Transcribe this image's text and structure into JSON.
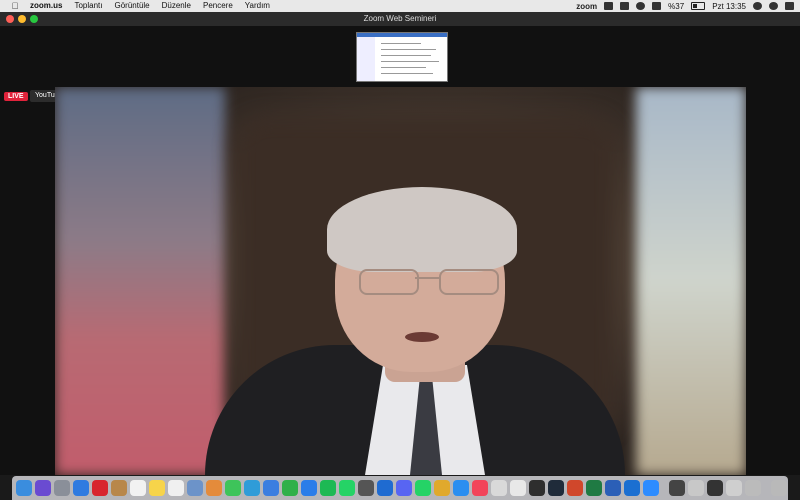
{
  "menubar": {
    "app_name": "zoom.us",
    "items": [
      "Toplantı",
      "Görüntüle",
      "Düzenle",
      "Pencere",
      "Yardım"
    ],
    "status": {
      "zoom": "zoom",
      "battery": "%37",
      "time": "Pzt 13:35"
    }
  },
  "window": {
    "title": "Zoom Web Semineri"
  },
  "stream": {
    "live_label": "LIVE",
    "platform_label": "YouTube"
  },
  "dock": {
    "apps": [
      {
        "name": "finder",
        "color": "#3a8dde"
      },
      {
        "name": "siri",
        "color": "#6a4bd1"
      },
      {
        "name": "launchpad",
        "color": "#8a8f99"
      },
      {
        "name": "safari",
        "color": "#2f7be0"
      },
      {
        "name": "opera",
        "color": "#d8252e"
      },
      {
        "name": "notes-brown",
        "color": "#b8874a"
      },
      {
        "name": "calendar",
        "color": "#f2f2f2"
      },
      {
        "name": "notes",
        "color": "#f7d44a"
      },
      {
        "name": "reminders",
        "color": "#f0f0f0"
      },
      {
        "name": "preview",
        "color": "#6c93c9"
      },
      {
        "name": "photos",
        "color": "#e48b3b"
      },
      {
        "name": "messages",
        "color": "#3ec45a"
      },
      {
        "name": "facetime-blue",
        "color": "#2f9cd8"
      },
      {
        "name": "keynote",
        "color": "#3b7ee0"
      },
      {
        "name": "numbers",
        "color": "#2fb04a"
      },
      {
        "name": "app-store",
        "color": "#2b7de9"
      },
      {
        "name": "spotify",
        "color": "#1db954"
      },
      {
        "name": "whatsapp",
        "color": "#25d366"
      },
      {
        "name": "camera",
        "color": "#555"
      },
      {
        "name": "outlook",
        "color": "#1f6bd1"
      },
      {
        "name": "discord",
        "color": "#5865f2"
      },
      {
        "name": "whatsapp-2",
        "color": "#25d366"
      },
      {
        "name": "chrome",
        "color": "#e0a92c"
      },
      {
        "name": "messenger",
        "color": "#2b8ef0"
      },
      {
        "name": "music",
        "color": "#f2445a"
      },
      {
        "name": "word-doc",
        "color": "#d9d9d9"
      },
      {
        "name": "sheets",
        "color": "#e8e8e8"
      },
      {
        "name": "activity-monitor",
        "color": "#2e2e2e"
      },
      {
        "name": "vpn",
        "color": "#1f2b3a"
      },
      {
        "name": "powerpoint",
        "color": "#d0472b"
      },
      {
        "name": "excel",
        "color": "#1f7a43"
      },
      {
        "name": "word",
        "color": "#2b5fb7"
      },
      {
        "name": "xcode",
        "color": "#1b6fd1"
      },
      {
        "name": "zoom",
        "color": "#2d8cff"
      },
      {
        "name": "window-1",
        "color": "#444"
      },
      {
        "name": "window-2",
        "color": "#c8c8c8"
      },
      {
        "name": "window-3",
        "color": "#333"
      },
      {
        "name": "window-4",
        "color": "#cfcfcf"
      },
      {
        "name": "window-5",
        "color": "#bbb"
      },
      {
        "name": "trash",
        "color": "#b9b9b9"
      }
    ]
  }
}
